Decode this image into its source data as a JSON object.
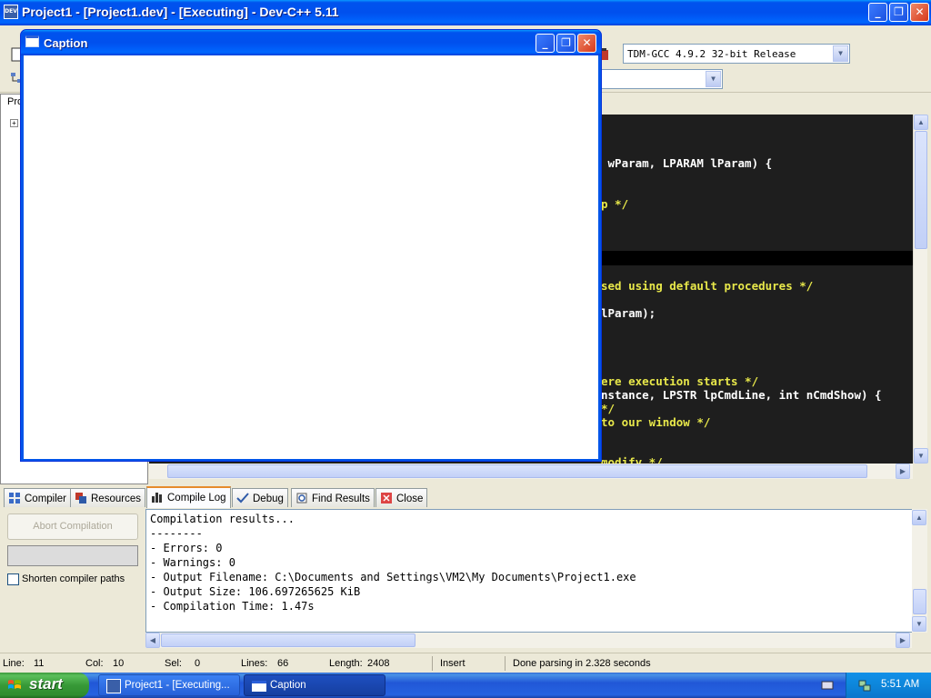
{
  "main_window": {
    "title": "Project1 - [Project1.dev] - [Executing] - Dev-C++ 5.11",
    "app_icon_text": "DEV",
    "minimize": "_",
    "maximize": "❐",
    "close": "✕"
  },
  "toolbar": {
    "compiler_select": "TDM-GCC 4.9.2 32-bit Release",
    "second_select": ""
  },
  "project_panel": {
    "tab_label": "Pro",
    "expand_glyph": "+"
  },
  "editor": {
    "lines": [
      {
        "text": " wParam, LPARAM lParam) {",
        "color": "#ffffff"
      },
      {
        "text": "p */",
        "color": "#e8e84a"
      },
      {
        "text": "sed using default procedures */",
        "color": "#e8e84a"
      },
      {
        "text": "lParam);",
        "color": "#ffffff"
      },
      {
        "text": "ere execution starts */",
        "color": "#e8e84a"
      },
      {
        "text": "nstance, LPSTR lpCmdLine, int nCmdShow) {",
        "color": "#ffffff"
      },
      {
        "text": "*/",
        "color": "#e8e84a"
      },
      {
        "text": "to our window */",
        "color": "#e8e84a"
      },
      {
        "text": "modify */",
        "color": "#e8e84a"
      }
    ]
  },
  "bottom_tabs": [
    {
      "label": "Compiler",
      "icon": "grid-icon"
    },
    {
      "label": "Resources",
      "icon": "resources-icon"
    },
    {
      "label": "Compile Log",
      "icon": "chart-icon"
    },
    {
      "label": "Debug",
      "icon": "check-icon"
    },
    {
      "label": "Find Results",
      "icon": "find-icon"
    },
    {
      "label": "Close",
      "icon": "close-tab-icon"
    }
  ],
  "compile_panel": {
    "abort_label": "Abort Compilation",
    "shorten_label": "Shorten compiler paths",
    "log_lines": [
      "Compilation results...",
      "--------",
      "- Errors: 0",
      "- Warnings: 0",
      "- Output Filename: C:\\Documents and Settings\\VM2\\My Documents\\Project1.exe",
      "- Output Size: 106.697265625 KiB",
      "- Compilation Time: 1.47s"
    ]
  },
  "status": {
    "line_label": "Line:",
    "line_value": "11",
    "col_label": "Col:",
    "col_value": "10",
    "sel_label": "Sel:",
    "sel_value": "0",
    "lines_label": "Lines:",
    "lines_value": "66",
    "length_label": "Length:",
    "length_value": "2408",
    "mode": "Insert",
    "message": "Done parsing in 2.328 seconds"
  },
  "taskbar": {
    "start_label": "start",
    "items": [
      {
        "label": "Project1 - [Executing..."
      },
      {
        "label": "Caption"
      }
    ],
    "clock": "5:51 AM"
  },
  "caption_window": {
    "title": "Caption"
  }
}
